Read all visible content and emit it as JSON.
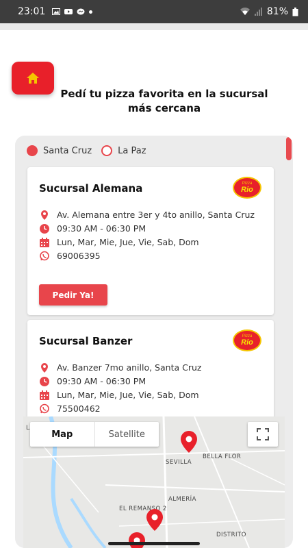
{
  "statusbar": {
    "time": "23:01",
    "battery": "81%",
    "left_icons": [
      "image-icon",
      "youtube-icon",
      "messenger-icon",
      "dot-icon"
    ],
    "right_icons": [
      "wifi-icon",
      "signal-icon",
      "battery-icon"
    ]
  },
  "header": {
    "home_icon": "home-icon",
    "headline": "Pedí tu pizza favorita en la sucursal más cercana"
  },
  "cities": {
    "options": [
      "Santa Cruz",
      "La Paz"
    ],
    "selected": "Santa Cruz"
  },
  "branches": [
    {
      "name": "Sucursal Alemana",
      "logo_top": "Pizza",
      "logo_main": "Rio",
      "address": "Av. Alemana entre 3er y 4to anillo, Santa Cruz",
      "hours": "09:30 AM - 06:30 PM",
      "days": "Lun, Mar, Mie, Jue, Vie, Sab, Dom",
      "phone": "69006395",
      "button": "Pedir Ya!"
    },
    {
      "name": "Sucursal Banzer",
      "logo_top": "Pizza",
      "logo_main": "Rio",
      "address": "Av. Banzer 7mo anillo, Santa Cruz",
      "hours": "09:30 AM - 06:30 PM",
      "days": "Lun, Mar, Mie, Jue, Vie, Sab, Dom",
      "phone": "75500462"
    }
  ],
  "map": {
    "toggle_map": "Map",
    "toggle_satellite": "Satellite",
    "labels": [
      "SEVILLA",
      "BELLA FLOR",
      "ALMERÍA",
      "EL REMANSO 2",
      "DISTRITO",
      "LA"
    ]
  },
  "colors": {
    "accent": "#e8454b",
    "home_button": "#e8202a",
    "panel_bg": "#ececec"
  }
}
